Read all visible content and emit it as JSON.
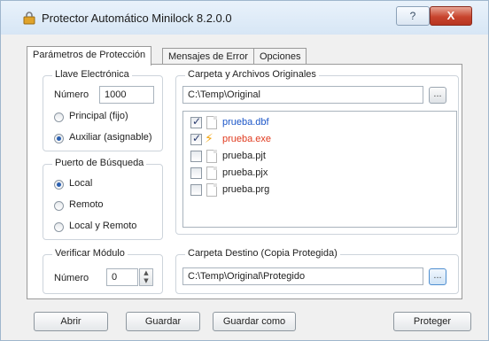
{
  "window": {
    "title": "Protector Automático Minilock 8.2.0.0",
    "help_label": "?",
    "close_label": "X"
  },
  "tabs": [
    {
      "label": "Parámetros de Protección"
    },
    {
      "label": "Mensajes de Error"
    },
    {
      "label": "Opciones"
    }
  ],
  "llave": {
    "title": "Llave Electrónica",
    "numero_label": "Número",
    "numero_value": "1000",
    "option1": "Principal (fijo)",
    "option2": "Auxiliar (asignable)",
    "selected": "Auxiliar (asignable)"
  },
  "puerto": {
    "title": "Puerto de Búsqueda",
    "option1": "Local",
    "option2": "Remoto",
    "option3": "Local y Remoto",
    "selected": "Local"
  },
  "verificar": {
    "title": "Verificar Módulo",
    "numero_label": "Número",
    "numero_value": "0"
  },
  "origen": {
    "title": "Carpeta y Archivos Originales",
    "path": "C:\\Temp\\Original",
    "browse_label": "...",
    "files": [
      {
        "name": "prueba.dbf",
        "checked": true,
        "color": "#1a55c8"
      },
      {
        "name": "prueba.exe",
        "checked": true,
        "color": "#e03a1e"
      },
      {
        "name": "prueba.pjt",
        "checked": false,
        "color": "#222222"
      },
      {
        "name": "prueba.pjx",
        "checked": false,
        "color": "#222222"
      },
      {
        "name": "prueba.prg",
        "checked": false,
        "color": "#222222"
      }
    ]
  },
  "destino": {
    "title": "Carpeta Destino (Copia Protegida)",
    "path": "C:\\Temp\\Original\\Protegido",
    "browse_label": "..."
  },
  "buttons": {
    "abrir": "Abrir",
    "guardar": "Guardar",
    "guardar_como": "Guardar como",
    "proteger": "Proteger"
  }
}
